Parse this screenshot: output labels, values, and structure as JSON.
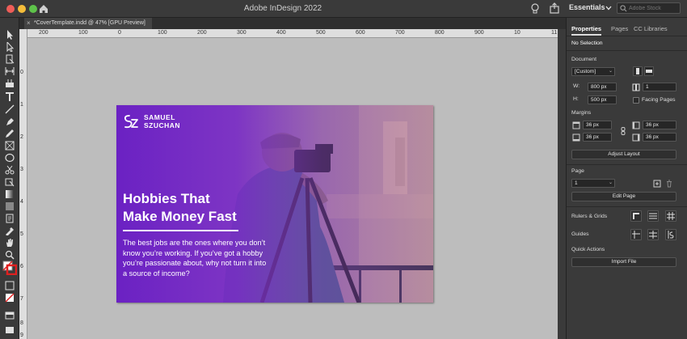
{
  "window": {
    "app_title": "Adobe InDesign 2022",
    "workspace": "Essentials",
    "stock_search_placeholder": "Adobe Stock"
  },
  "document_tab": {
    "close_glyph": "×",
    "label": "*CoverTemplate.indd @ 47% [GPU Preview]"
  },
  "rulers": {
    "horizontal_labels": [
      "200",
      "100",
      "0",
      "100",
      "200",
      "300",
      "400",
      "500",
      "600",
      "700",
      "800",
      "900",
      "10",
      "11"
    ],
    "vertical_labels": [
      "0",
      "1",
      "2",
      "3",
      "4",
      "5",
      "6",
      "7",
      "8",
      "9"
    ]
  },
  "cover": {
    "brand_line1": "SAMUEL",
    "brand_line2": "SZUCHAN",
    "headline_line1": "Hobbies That",
    "headline_line2": "Make Money Fast",
    "body": "The best jobs are the ones where you don’t know you’re working. If you’ve got a hobby you’re passionate about, why not turn it into a source of income?",
    "accent_color": "#6a1fc4"
  },
  "panel": {
    "tabs": [
      "Properties",
      "Pages",
      "CC Libraries"
    ],
    "selection": "No Selection",
    "document": {
      "title": "Document",
      "preset": "[Custom]",
      "width_label": "W:",
      "width": "800 px",
      "height_label": "H:",
      "height": "500 px",
      "pages_count": "1",
      "facing_pages": "Facing Pages"
    },
    "margins": {
      "title": "Margins",
      "top": "36 px",
      "bottom": "36 px",
      "left": "36 px",
      "right": "36 px",
      "adjust_layout": "Adjust Layout"
    },
    "page": {
      "title": "Page",
      "current": "1",
      "edit_page": "Edit Page"
    },
    "rulers_grids": "Rulers & Grids",
    "guides": "Guides",
    "quick_actions": {
      "title": "Quick Actions",
      "import_file": "Import File"
    }
  }
}
